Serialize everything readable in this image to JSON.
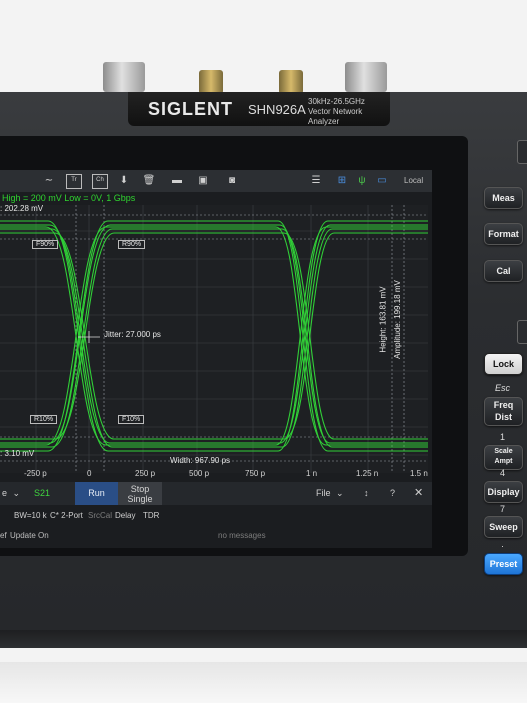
{
  "brand": {
    "logo": "SIGLENT",
    "model": "SHN926A",
    "range": "30kHz-26.5GHz",
    "type": "Vector Network Analyzer"
  },
  "toolbar": {
    "local_label": "Local",
    "icons": [
      "marker-icon",
      "tr-icon",
      "ch-icon",
      "marker-add-icon",
      "trash-icon",
      "open-folder-icon",
      "save-icon",
      "camera-icon",
      "list-icon",
      "network-icon",
      "signal-icon",
      "battery-icon"
    ]
  },
  "info": {
    "line": "High = 200 mV  Low = 0V,  1 Gbps"
  },
  "plot": {
    "top_label": ": 202.28 mV",
    "bottom_label": ": 3.10 mV",
    "f90": "F90%",
    "r90": "R90%",
    "r10": "R10%",
    "f10": "F10%",
    "jitter": "Jitter: 27.000 ps",
    "width": "Width: 967.90 ps",
    "height": "Height: 163.81 mV",
    "amplitude": "Amplitude: 199.18 mV",
    "trace_color": "#33e23a"
  },
  "xaxis": {
    "ticks": [
      "-250 p",
      "0",
      "250 p",
      "500 p",
      "750 p",
      "1 n",
      "1.25 n",
      "1.5 n"
    ]
  },
  "controls": {
    "prefix": "e",
    "trace": "S21",
    "run": "Run",
    "stop": "Stop",
    "single": "Single",
    "file": "File"
  },
  "status": {
    "items": [
      "BW=10 k",
      "C* 2-Port",
      "SrcCal",
      "Delay",
      "TDR"
    ]
  },
  "messages": {
    "left1": "ef",
    "left2": "Update On",
    "center": "no messages"
  },
  "keys": {
    "meas": "Meas",
    "format": "Format",
    "cal": "Cal",
    "lock": "Lock",
    "esc": "Esc",
    "freq": "Freq Dist",
    "n1": "1",
    "scale": "Scale Ampt",
    "n4": "4",
    "display": "Display",
    "n7": "7",
    "sweep": "Sweep",
    "dot": ".",
    "preset": "Preset"
  }
}
